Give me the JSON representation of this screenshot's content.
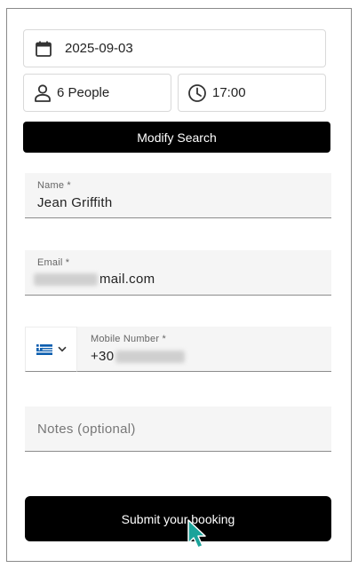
{
  "search": {
    "date": "2025-09-03",
    "people": "6 People",
    "time": "17:00",
    "modify_label": "Modify Search"
  },
  "form": {
    "name_label": "Name *",
    "name_value": "Jean Griffith",
    "email_label": "Email *",
    "email_visible_suffix": "mail.com",
    "phone_label": "Mobile Number *",
    "phone_prefix": "+30",
    "country_flag": "greece-flag",
    "notes_placeholder": "Notes (optional)",
    "submit_label": "Submit your booking"
  },
  "icons": {
    "calendar": "calendar-icon",
    "person": "person-icon",
    "clock": "clock-icon",
    "cursor": "cursor-icon"
  },
  "colors": {
    "button": "#000000",
    "cursor": "#1aa39a"
  }
}
